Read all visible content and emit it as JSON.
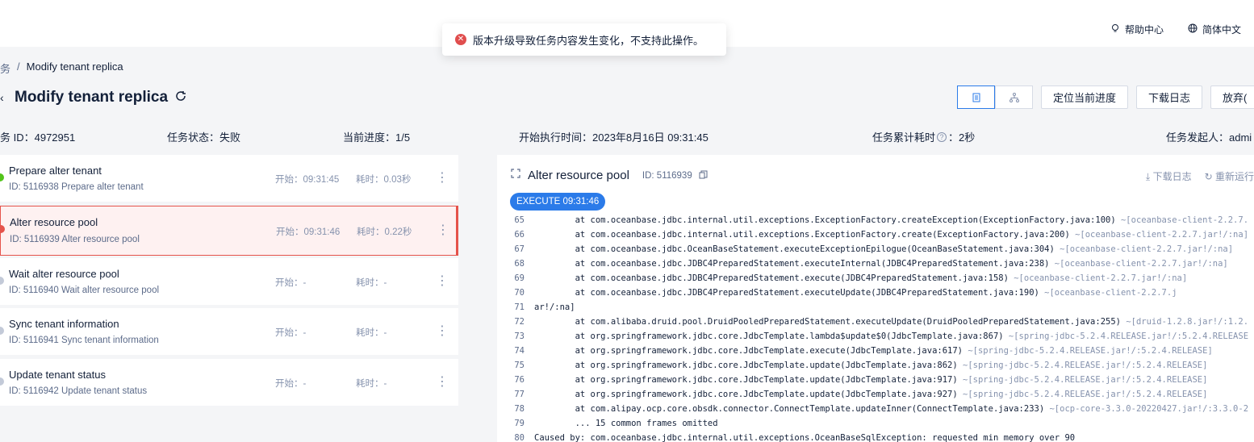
{
  "header": {
    "help_label": "帮助中心",
    "lang_label": "简体中文"
  },
  "toast": {
    "message": "版本升级导致任务内容发生变化，不支持此操作。",
    "status_color": "#e04e4e"
  },
  "breadcrumb": {
    "parent": "务",
    "separator": "/",
    "current": "Modify tenant replica"
  },
  "page": {
    "title": "Modify tenant replica",
    "refresh_icon": "refresh-icon"
  },
  "toolbar": {
    "view_list_icon": "list-view-icon",
    "view_tree_icon": "tree-view-icon",
    "locate_label": "定位当前进度",
    "download_log_label": "下载日志",
    "abandon_label": "放弃("
  },
  "meta": {
    "task_id": "务 ID：4972951",
    "status": "任务状态：失败",
    "progress": "当前进度：1/5",
    "start_time": "开始执行时间：2023年8月16日 09:31:45",
    "elapsed": "任务累计耗时",
    "elapsed_value": "：2秒",
    "initiator": "任务发起人：admi"
  },
  "tasks": [
    {
      "name": "Prepare alter tenant",
      "id": "ID: 5116938  Prepare alter tenant",
      "start": "开始：09:31:45",
      "duration": "耗时：0.03秒",
      "status_color": "#52c41a"
    },
    {
      "name": "Alter resource pool",
      "id": "ID: 5116939  Alter resource pool",
      "start": "开始：09:31:46",
      "duration": "耗时：0.22秒",
      "status_color": "#e5534b"
    },
    {
      "name": "Wait alter resource pool",
      "id": "ID: 5116940  Wait alter resource pool",
      "start": "开始：-",
      "duration": "耗时：-",
      "status_color": "#c3cad8"
    },
    {
      "name": "Sync tenant information",
      "id": "ID: 5116941  Sync tenant information",
      "start": "开始：-",
      "duration": "耗时：-",
      "status_color": "#c3cad8"
    },
    {
      "name": "Update tenant status",
      "id": "ID: 5116942  Update tenant status",
      "start": "开始：-",
      "duration": "耗时：-",
      "status_color": "#c3cad8"
    }
  ],
  "detail": {
    "title": "Alter resource pool",
    "id": "ID: 5116939",
    "download_log": "下载日志",
    "rerun": "重新运行",
    "exec_tag": "EXECUTE 09:31:46"
  },
  "log_lines": [
    {
      "n": "65",
      "code": "        at com.oceanbase.jdbc.internal.util.exceptions.ExceptionFactory.createException(ExceptionFactory.java:100) ",
      "lib": "~[oceanbase-client-2.2.7."
    },
    {
      "n": "66",
      "code": "        at com.oceanbase.jdbc.internal.util.exceptions.ExceptionFactory.create(ExceptionFactory.java:200) ",
      "lib": "~[oceanbase-client-2.2.7.jar!/:na]"
    },
    {
      "n": "67",
      "code": "        at com.oceanbase.jdbc.OceanBaseStatement.executeExceptionEpilogue(OceanBaseStatement.java:304) ",
      "lib": "~[oceanbase-client-2.2.7.jar!/:na]"
    },
    {
      "n": "68",
      "code": "        at com.oceanbase.jdbc.JDBC4PreparedStatement.executeInternal(JDBC4PreparedStatement.java:238) ",
      "lib": "~[oceanbase-client-2.2.7.jar!/:na]"
    },
    {
      "n": "69",
      "code": "        at com.oceanbase.jdbc.JDBC4PreparedStatement.execute(JDBC4PreparedStatement.java:158) ",
      "lib": "~[oceanbase-client-2.2.7.jar!/:na]"
    },
    {
      "n": "70",
      "code": "        at com.oceanbase.jdbc.JDBC4PreparedStatement.executeUpdate(JDBC4PreparedStatement.java:190) ",
      "lib": "~[oceanbase-client-2.2.7.j"
    },
    {
      "n": "71",
      "code": "ar!/:na]",
      "lib": ""
    },
    {
      "n": "72",
      "code": "        at com.alibaba.druid.pool.DruidPooledPreparedStatement.executeUpdate(DruidPooledPreparedStatement.java:255) ",
      "lib": "~[druid-1.2.8.jar!/:1.2."
    },
    {
      "n": "73",
      "code": "        at org.springframework.jdbc.core.JdbcTemplate.lambda$update$0(JdbcTemplate.java:867) ",
      "lib": "~[spring-jdbc-5.2.4.RELEASE.jar!/:5.2.4.RELEASE"
    },
    {
      "n": "74",
      "code": "        at org.springframework.jdbc.core.JdbcTemplate.execute(JdbcTemplate.java:617) ",
      "lib": "~[spring-jdbc-5.2.4.RELEASE.jar!/:5.2.4.RELEASE]"
    },
    {
      "n": "75",
      "code": "        at org.springframework.jdbc.core.JdbcTemplate.update(JdbcTemplate.java:862) ",
      "lib": "~[spring-jdbc-5.2.4.RELEASE.jar!/:5.2.4.RELEASE]"
    },
    {
      "n": "76",
      "code": "        at org.springframework.jdbc.core.JdbcTemplate.update(JdbcTemplate.java:917) ",
      "lib": "~[spring-jdbc-5.2.4.RELEASE.jar!/:5.2.4.RELEASE]"
    },
    {
      "n": "77",
      "code": "        at org.springframework.jdbc.core.JdbcTemplate.update(JdbcTemplate.java:927) ",
      "lib": "~[spring-jdbc-5.2.4.RELEASE.jar!/:5.2.4.RELEASE]"
    },
    {
      "n": "78",
      "code": "        at com.alipay.ocp.core.obsdk.connector.ConnectTemplate.updateInner(ConnectTemplate.java:233) ",
      "lib": "~[ocp-core-3.3.0-20220427.jar!/:3.3.0-2"
    },
    {
      "n": "79",
      "code": "        ... 15 common frames omitted",
      "lib": ""
    },
    {
      "n": "80",
      "code": "Caused by: com.oceanbase.jdbc.internal.util.exceptions.OceanBaseSqlException: requested min_memory over 90",
      "lib": ""
    }
  ]
}
